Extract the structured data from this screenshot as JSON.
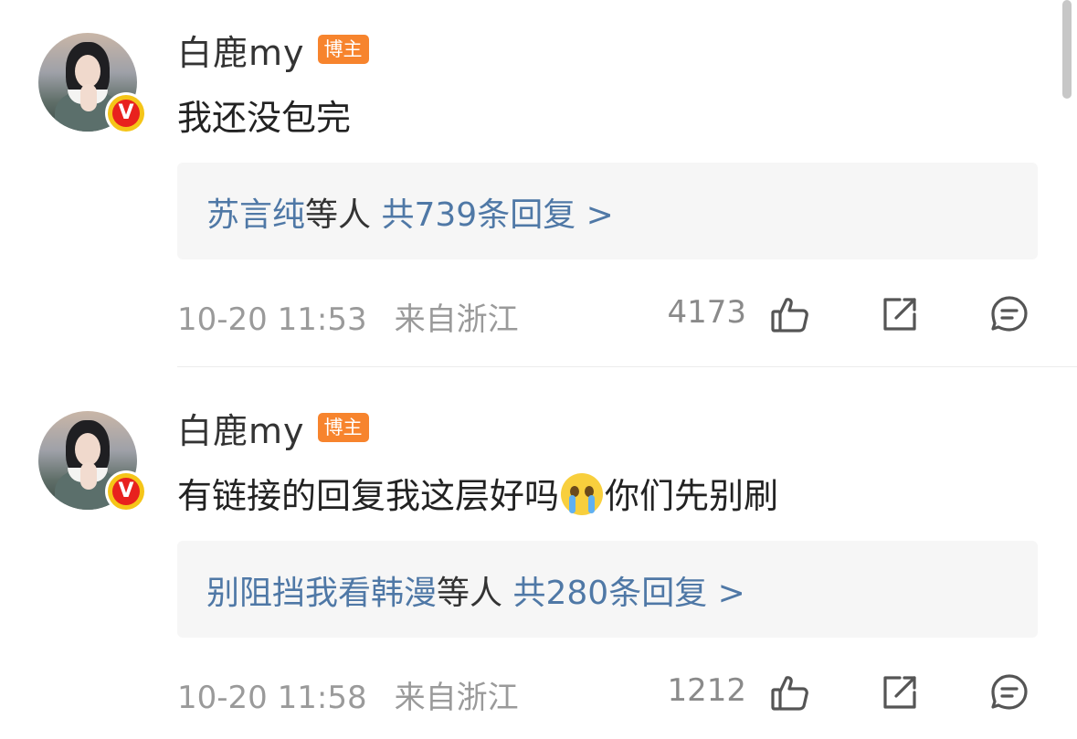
{
  "comments": [
    {
      "name": "白鹿my",
      "tag": "博主",
      "verified": "V",
      "text": "我还没包完",
      "replies": {
        "users": "苏言纯",
        "suffix": "等人",
        "total": "共739条回复 >"
      },
      "time": "10-20 11:53",
      "location": "来自浙江",
      "likes": "4173"
    },
    {
      "name": "白鹿my",
      "tag": "博主",
      "verified": "V",
      "text_before": "有链接的回复我这层好吗",
      "text_after": "你们先别刷",
      "emoji": "loudly-crying-face",
      "replies": {
        "users": "别阻挡我看韩漫",
        "suffix": "等人",
        "total": "共280条回复 >"
      },
      "time": "10-20 11:58",
      "location": "来自浙江",
      "likes": "1212"
    }
  ],
  "colors": {
    "link_blue": "#4f78a6",
    "tag_orange": "#f7842d",
    "verified_red": "#e8211e",
    "verified_gold": "#f5c518",
    "meta_gray": "#9a9a9a",
    "reply_bg": "#f6f6f6"
  },
  "icons": [
    "like-icon",
    "share-icon",
    "comment-icon"
  ]
}
